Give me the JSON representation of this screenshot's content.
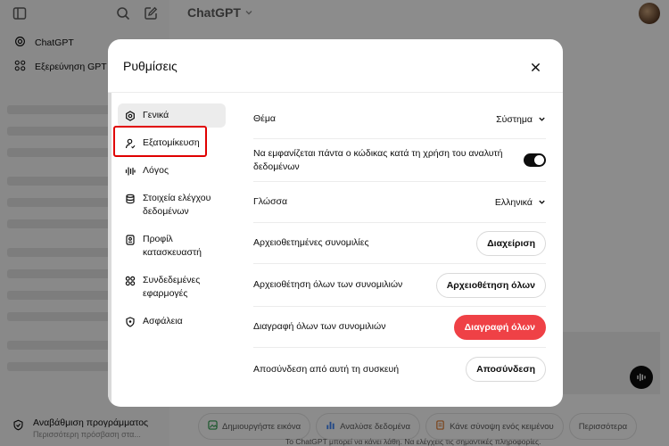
{
  "sidebar": {
    "items": [
      {
        "label": "ChatGPT",
        "icon": "openai-icon"
      },
      {
        "label": "Εξερεύνηση GPT",
        "icon": "grid-icon"
      }
    ],
    "upgrade": {
      "title": "Αναβάθμιση προγράμματος",
      "subtitle": "Περισσότερη πρόσβαση στα..."
    }
  },
  "header": {
    "model": "ChatGPT"
  },
  "chips": [
    {
      "label": "Δημιουργήστε εικόνα",
      "color": "#2e9e4f"
    },
    {
      "label": "Αναλύσε δεδομένα",
      "color": "#3b82f6"
    },
    {
      "label": "Κάνε σύνοψη ενός κειμένου",
      "color": "#e07a2e"
    },
    {
      "label": "Περισσότερα",
      "color": ""
    }
  ],
  "disclaimer": "Το ChatGPT μπορεί να κάνει λάθη. Να ελέγχεις τις σημαντικές πληροφορίες.",
  "modal": {
    "title": "Ρυθμίσεις",
    "nav": [
      {
        "label": "Γενικά",
        "icon": "gear-icon"
      },
      {
        "label": "Εξατομίκευση",
        "icon": "person-icon"
      },
      {
        "label": "Λόγος",
        "icon": "waveform-icon"
      },
      {
        "label": "Στοιχεία ελέγχου δεδομένων",
        "icon": "database-icon"
      },
      {
        "label": "Προφίλ κατασκευαστή",
        "icon": "id-card-icon"
      },
      {
        "label": "Συνδεδεμένες εφαρμογές",
        "icon": "apps-icon"
      },
      {
        "label": "Ασφάλεια",
        "icon": "shield-icon"
      }
    ],
    "settings": {
      "theme": {
        "label": "Θέμα",
        "value": "Σύστημα"
      },
      "code": {
        "label": "Να εμφανίζεται πάντα ο κώδικας κατά τη χρήση του αναλυτή δεδομένων",
        "enabled": true
      },
      "language": {
        "label": "Γλώσσα",
        "value": "Ελληνικά"
      },
      "archived": {
        "label": "Αρχειοθετημένες συνομιλίες",
        "button": "Διαχείριση"
      },
      "archive_all": {
        "label": "Αρχειοθέτηση όλων των συνομιλιών",
        "button": "Αρχειοθέτηση όλων"
      },
      "delete_all": {
        "label": "Διαγραφή όλων των συνομιλιών",
        "button": "Διαγραφή όλων"
      },
      "logout": {
        "label": "Αποσύνδεση από αυτή τη συσκευή",
        "button": "Αποσύνδεση"
      }
    }
  },
  "colors": {
    "danger": "#ef4146",
    "highlight": "#e00000"
  }
}
